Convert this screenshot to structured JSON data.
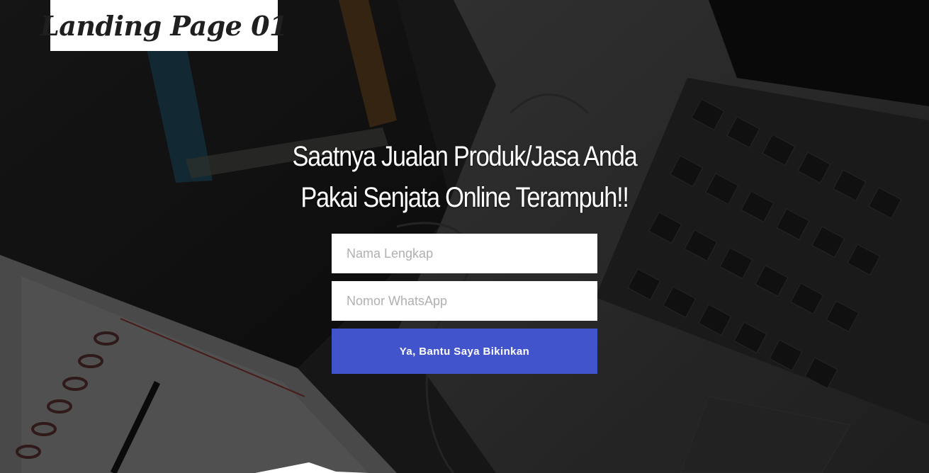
{
  "logo": {
    "text": "Landing Page 01"
  },
  "hero": {
    "headline_line1": "Saatnya Jualan Produk/Jasa Anda",
    "headline_line2": "Pakai Senjata Online Terampuh!!"
  },
  "form": {
    "name_placeholder": "Nama Lengkap",
    "name_value": "",
    "whatsapp_placeholder": "Nomor WhatsApp",
    "whatsapp_value": "",
    "submit_label": "Ya, Bantu Saya Bikinkan"
  },
  "colors": {
    "accent": "#4154cc",
    "field_background": "#ffffff",
    "headline": "#ffffff"
  },
  "icons": [
    "background-desk-photo",
    "bottom-divider-shape"
  ]
}
